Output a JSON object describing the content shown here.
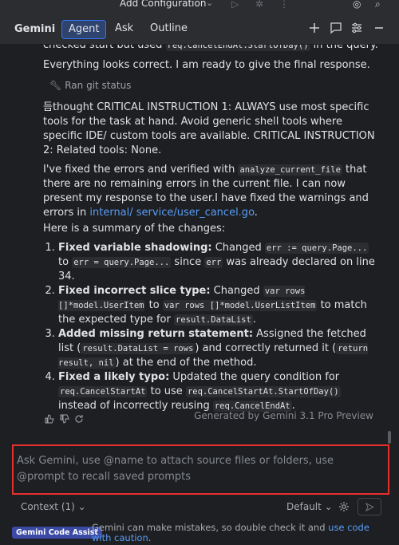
{
  "topbar": {
    "config_label": "Add Configuration"
  },
  "tabsbar": {
    "title": "Gemini",
    "tabs": [
      "Agent",
      "Ask",
      "Outline"
    ]
  },
  "chat": {
    "cut_line_pre": "checked start but used ",
    "cut_line_code": "req.CancelEndAt.StartOfDay()",
    "cut_line_post": " in the query.",
    "ready_text": "Everything looks correct. I am ready to give the final response.",
    "ran_text": "Ran git status",
    "thought_text": "듬thought CRITICAL INSTRUCTION 1: ALWAYS use most specific tools for the task at hand. Avoid generic shell tools where specific IDE/ custom tools are available. CRITICAL INSTRUCTION 2: Related tools: None.",
    "fixed_pre": "I've fixed the errors and verified with ",
    "fixed_code": "analyze_current_file",
    "fixed_mid": " that there are no remaining errors in the current file. I can now present my response to the user.I have fixed the warnings and errors in ",
    "fixed_link": "internal/ service/user_cancel.go",
    "fixed_end": ".",
    "summary_intro": "Here is a summary of the changes:",
    "changes": [
      {
        "title": "Fixed variable shadowing:",
        "t1": " Changed ",
        "c1": "err := query.Page...",
        "t2": " to ",
        "c2": "err = query.Page...",
        "t3": " since ",
        "c3": "err",
        "t4": " was already declared on line 34."
      },
      {
        "title": "Fixed incorrect slice type:",
        "t1": " Changed ",
        "c1": "var rows []*model.UserItem",
        "t2": " to ",
        "c2": "var rows []*model.UserListItem",
        "t3": " to match the expected type for ",
        "c3": "result.DataList",
        "t4": "."
      },
      {
        "title": "Added missing return statement:",
        "t1": " Assigned the fetched list (",
        "c1": "result.DataList = rows",
        "t2": ") and correctly returned it (",
        "c2": "return result, nil",
        "t3": ") at the end of the method.",
        "c3": "",
        "t4": ""
      },
      {
        "title": "Fixed a likely typo:",
        "t1": " Updated the query condition for ",
        "c1": "req.CancelStartAt",
        "t2": " to use ",
        "c2": "req.CancelStartAt.StartOfDay()",
        "t3": " instead of incorrectly reusing ",
        "c3": "req.CancelEndAt",
        "t4": "."
      }
    ],
    "generated_by": "Generated by Gemini 3.1 Pro Preview"
  },
  "input": {
    "placeholder": "Ask Gemini, use @name to attach source files or folders, use @prompt to recall saved prompts"
  },
  "context_bar": {
    "context_label": "Context (1)",
    "model_label": "Default"
  },
  "footer": {
    "badge": "Gemini Code Assist",
    "disclaimer_text": "Gemini can make mistakes, so double check it and ",
    "disclaimer_link": "use code with caution",
    "disclaimer_end": "."
  },
  "colors": {
    "accent": "#3574f0",
    "link": "#589df6",
    "highlight_border": "#e5302d",
    "background": "#1e1f22"
  }
}
